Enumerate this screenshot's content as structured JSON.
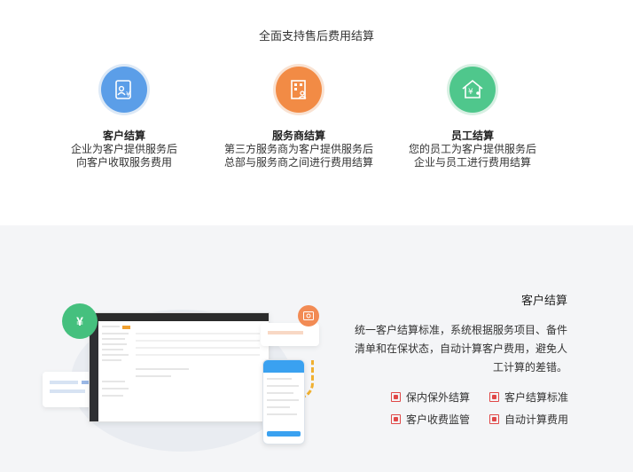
{
  "section_title": "全面支持售后费用结算",
  "cards": [
    {
      "title": "客户结算",
      "line1": "企业为客户提供服务后",
      "line2": "向客户收取服务费用",
      "color": "#5b9ee8",
      "ring": "#dde9f6",
      "icon": "customer-settlement-icon"
    },
    {
      "title": "服务商结算",
      "line1": "第三方服务商为客户提供服务后",
      "line2": "总部与服务商之间进行费用结算",
      "color": "#f28b45",
      "ring": "#f9e2d2",
      "icon": "provider-settlement-icon"
    },
    {
      "title": "员工结算",
      "line1": "您的员工为客户提供服务后",
      "line2": "企业与员工进行费用结算",
      "color": "#4fc78c",
      "ring": "#d8f0e3",
      "icon": "employee-settlement-icon"
    }
  ],
  "detail": {
    "title": "客户结算",
    "desc_line1": "统一客户结算标准，系统根据服务项目、备件",
    "desc_line2": "清单和在保状态，自动计算客户费用，避免人",
    "desc_line3": "工计算的差错。",
    "features": [
      "保内保外结算",
      "客户结算标准",
      "客户收费监管",
      "自动计算费用"
    ],
    "accent": "#e04848"
  },
  "illustration": {
    "badge_symbol": "¥",
    "green": "#45c07e",
    "orange": "#f28b54",
    "blue": "#3aa1f0"
  }
}
